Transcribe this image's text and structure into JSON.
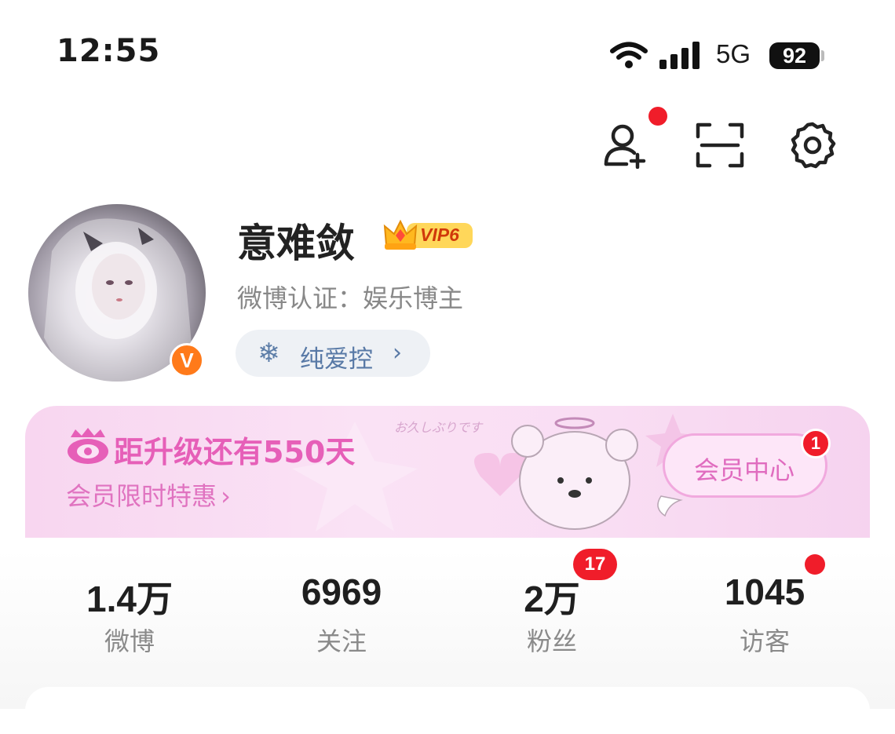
{
  "status_bar": {
    "time": "12:55",
    "network": "5G",
    "battery": "92"
  },
  "top_actions": [
    "add-friend",
    "scan",
    "settings"
  ],
  "profile": {
    "username": "意难敛",
    "vip_level": "VIP6",
    "certification": "微博认证：娱乐博主",
    "tag": "纯爱控",
    "verified_badge": "V"
  },
  "banner": {
    "title": "距升级还有550天",
    "subtitle": "会员限时特惠",
    "decor_text": "お久しぶりです",
    "member_button": "会员中心",
    "member_badge": "1"
  },
  "stats": [
    {
      "value": "1.4万",
      "label": "微博"
    },
    {
      "value": "6969",
      "label": "关注"
    },
    {
      "value": "2万",
      "label": "粉丝",
      "badge": "17"
    },
    {
      "value": "1045",
      "label": "访客"
    }
  ],
  "colors": {
    "accent_pink": "#e65fb8",
    "red_dot": "#f01d2a",
    "verified_orange": "#ff7a1a",
    "tag_blue": "#5879a6"
  }
}
